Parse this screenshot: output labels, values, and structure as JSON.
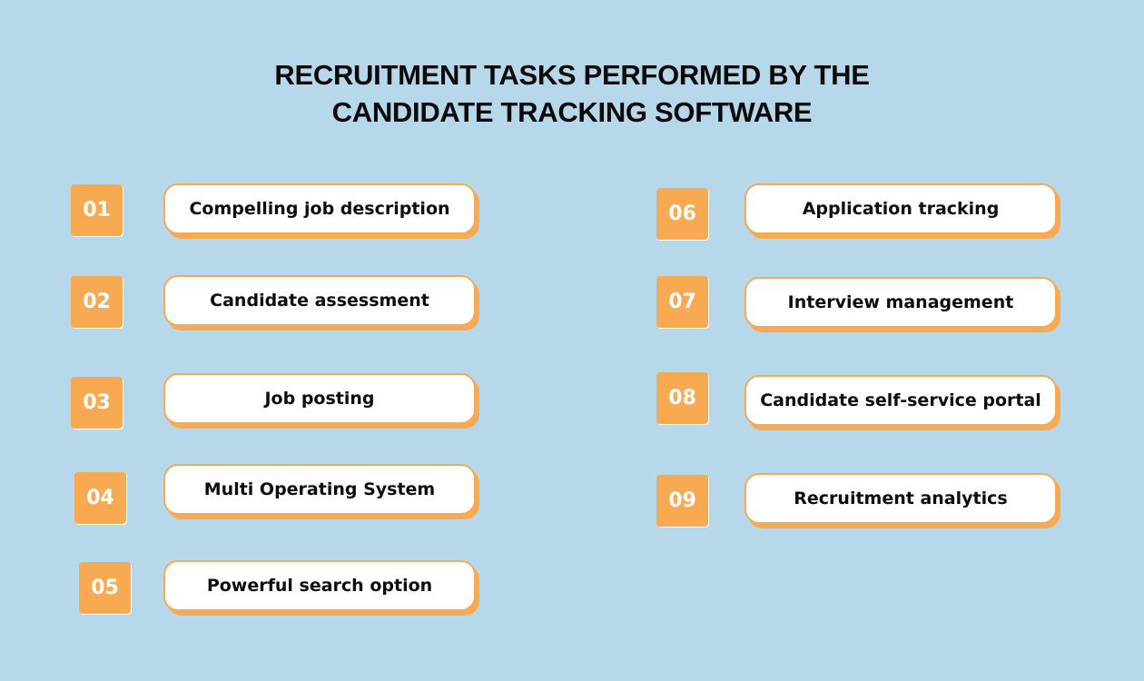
{
  "title": {
    "line1": "RECRUITMENT TASKS PERFORMED BY THE",
    "line2": "CANDIDATE TRACKING SOFTWARE"
  },
  "colors": {
    "background": "#b7d8ea",
    "accent": "#f7aa52",
    "card": "#ffffff",
    "text": "#0d0d0d"
  },
  "tasks": [
    {
      "number": "01",
      "label": "Compelling job description"
    },
    {
      "number": "02",
      "label": "Candidate assessment"
    },
    {
      "number": "03",
      "label": "Job posting"
    },
    {
      "number": "04",
      "label": "Multi Operating System"
    },
    {
      "number": "05",
      "label": "Powerful search option"
    },
    {
      "number": "06",
      "label": "Application tracking"
    },
    {
      "number": "07",
      "label": "Interview management"
    },
    {
      "number": "08",
      "label": "Candidate self-service portal"
    },
    {
      "number": "09",
      "label": "Recruitment analytics"
    }
  ]
}
